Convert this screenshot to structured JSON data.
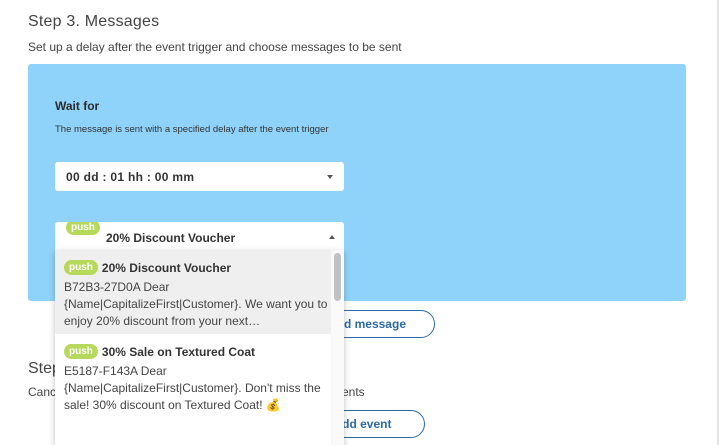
{
  "step3": {
    "title": "Step 3. Messages",
    "subtitle": "Set up a delay after the event trigger and choose messages to be sent"
  },
  "wait": {
    "title": "Wait for",
    "description": "The message is sent with a specified delay after the event trigger",
    "delay_value": "00 dd : 01 hh : 00 mm"
  },
  "message_select": {
    "badge": "push",
    "selected_title": "20% Discount Voucher"
  },
  "dropdown": {
    "options": [
      {
        "badge": "push",
        "title": "20% Discount Voucher",
        "body": "B72B3-27D0A Dear {Name|CapitalizeFirst|Customer}. We want you to enjoy 20% discount from your next…"
      },
      {
        "badge": "push",
        "title": "30% Sale on Textured Coat",
        "body": "E5187-F143A Dear {Name|CapitalizeFirst|Customer}. Don't miss the sale! 30% discount on Textured Coat! 💰"
      }
    ]
  },
  "buttons": {
    "add_message": "+ Add message",
    "add_event": "+ Add event"
  },
  "step4": {
    "title_partial": "Step",
    "subtitle_partial_start": "Canc",
    "subtitle_partial_end": "ents"
  },
  "colors": {
    "panel_bg": "#8fd3fb",
    "badge_bg": "#b6d95c",
    "button_accent": "#2c6aa6"
  }
}
